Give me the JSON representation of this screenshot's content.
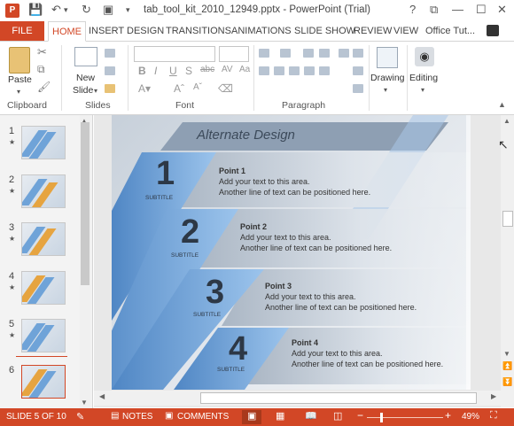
{
  "window": {
    "title": "tab_tool_kit_2010_12949.pptx - PowerPoint (Trial)",
    "app_icon_letter": "P",
    "controls": [
      "?",
      "⧉",
      "—",
      "☐",
      "✕"
    ]
  },
  "ribbon_tabs": {
    "file": "FILE",
    "items": [
      "HOME",
      "INSERT",
      "DESIGN",
      "TRANSITIONS",
      "ANIMATIONS",
      "SLIDE SHOW",
      "REVIEW",
      "VIEW"
    ],
    "account": "Office Tut..."
  },
  "ribbon": {
    "clipboard": {
      "paste": "Paste",
      "label": "Clipboard"
    },
    "slides": {
      "new_slide_line1": "New",
      "new_slide_line2": "Slide",
      "label": "Slides"
    },
    "font": {
      "label": "Font",
      "buttons": [
        "B",
        "I",
        "U",
        "S",
        "abc",
        "AV",
        "Aa"
      ]
    },
    "paragraph": {
      "label": "Paragraph"
    },
    "drawing": {
      "label": "Drawing"
    },
    "editing": {
      "label": "Editing"
    }
  },
  "thumbnails": [
    {
      "num": "1",
      "star": "★"
    },
    {
      "num": "2",
      "star": "★"
    },
    {
      "num": "3",
      "star": "★"
    },
    {
      "num": "4",
      "star": "★"
    },
    {
      "num": "5",
      "star": "★"
    },
    {
      "num": "6",
      "star": ""
    }
  ],
  "slide": {
    "title": "Alternate Design",
    "points": [
      {
        "number": "1",
        "subtitle": "SUBTITLE",
        "heading": "Point 1",
        "line1": "Add your text to this area.",
        "line2": "Another line of text can be positioned here."
      },
      {
        "number": "2",
        "subtitle": "SUBTITLE",
        "heading": "Point 2",
        "line1": "Add your text to this area.",
        "line2": "Another line of text can be positioned here."
      },
      {
        "number": "3",
        "subtitle": "SUBTITLE",
        "heading": "Point 3",
        "line1": "Add your text to this area.",
        "line2": "Another line of text can be positioned here."
      },
      {
        "number": "4",
        "subtitle": "SUBTITLE",
        "heading": "Point 4",
        "line1": "Add your text to this area.",
        "line2": "Another line of text can be positioned here."
      }
    ]
  },
  "status": {
    "slide_info": "SLIDE 5 OF 10",
    "notes": "NOTES",
    "comments": "COMMENTS",
    "zoom_minus": "−",
    "zoom_plus": "+",
    "zoom": "49%"
  },
  "colors": {
    "accent": "#d24726",
    "band": "#6fa3d8",
    "band_dark": "#4f86c4"
  }
}
